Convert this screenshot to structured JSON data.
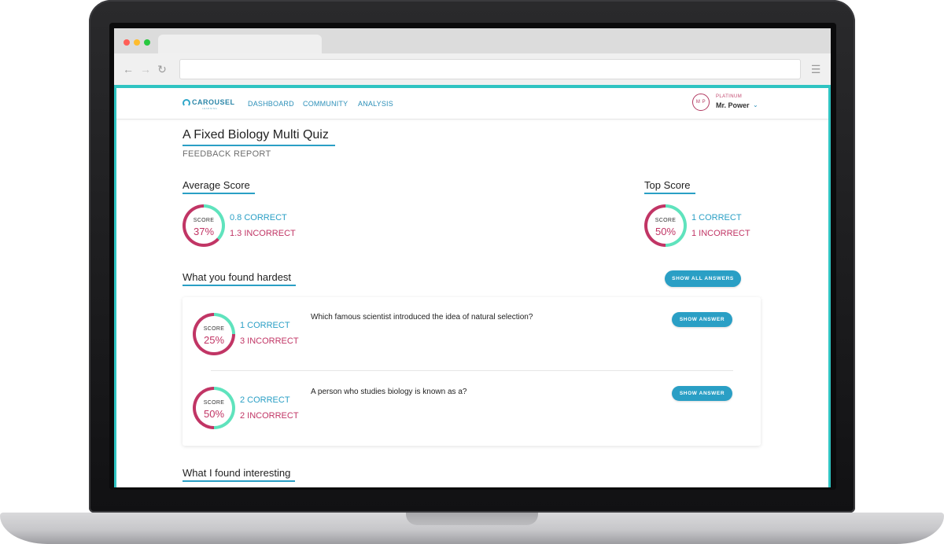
{
  "header": {
    "logo_text": "CAROUSEL",
    "logo_sub": "LEARNING",
    "nav": [
      "DASHBOARD",
      "COMMUNITY",
      "ANALYSIS"
    ],
    "user": {
      "initials": "M P",
      "tier": "PLATINUM",
      "name": "Mr. Power"
    }
  },
  "page": {
    "title": "A Fixed Biology Multi Quiz",
    "subtitle": "FEEDBACK REPORT"
  },
  "average": {
    "heading": "Average Score",
    "score_label": "SCORE",
    "score": "37%",
    "score_fraction": 0.37,
    "correct": "0.8 CORRECT",
    "incorrect": "1.3 INCORRECT"
  },
  "top": {
    "heading": "Top Score",
    "score_label": "SCORE",
    "score": "50%",
    "score_fraction": 0.5,
    "correct": "1 CORRECT",
    "incorrect": "1 INCORRECT"
  },
  "hardest": {
    "heading": "What you found hardest",
    "show_all_label": "SHOW ALL ANSWERS",
    "questions": [
      {
        "score_label": "SCORE",
        "score": "25%",
        "score_fraction": 0.25,
        "correct": "1 CORRECT",
        "incorrect": "3 INCORRECT",
        "question": "Which famous scientist introduced the idea of natural selection?",
        "button_label": "SHOW ANSWER"
      },
      {
        "score_label": "SCORE",
        "score": "50%",
        "score_fraction": 0.5,
        "correct": "2 CORRECT",
        "incorrect": "2 INCORRECT",
        "question": "A person who studies biology is known as a?",
        "button_label": "SHOW ANSWER"
      }
    ]
  },
  "interesting": {
    "heading": "What I found interesting"
  },
  "colors": {
    "accent": "#2a9fc5",
    "correct_ring": "#5fe3bd",
    "incorrect_ring": "#c13565",
    "teal_frame": "#2fc4c2"
  },
  "icons": {
    "back": "back-arrow-icon",
    "forward": "forward-arrow-icon",
    "reload": "reload-icon",
    "menu": "hamburger-menu-icon",
    "logo": "carousel-logo-icon",
    "chevron": "chevron-down-icon"
  }
}
